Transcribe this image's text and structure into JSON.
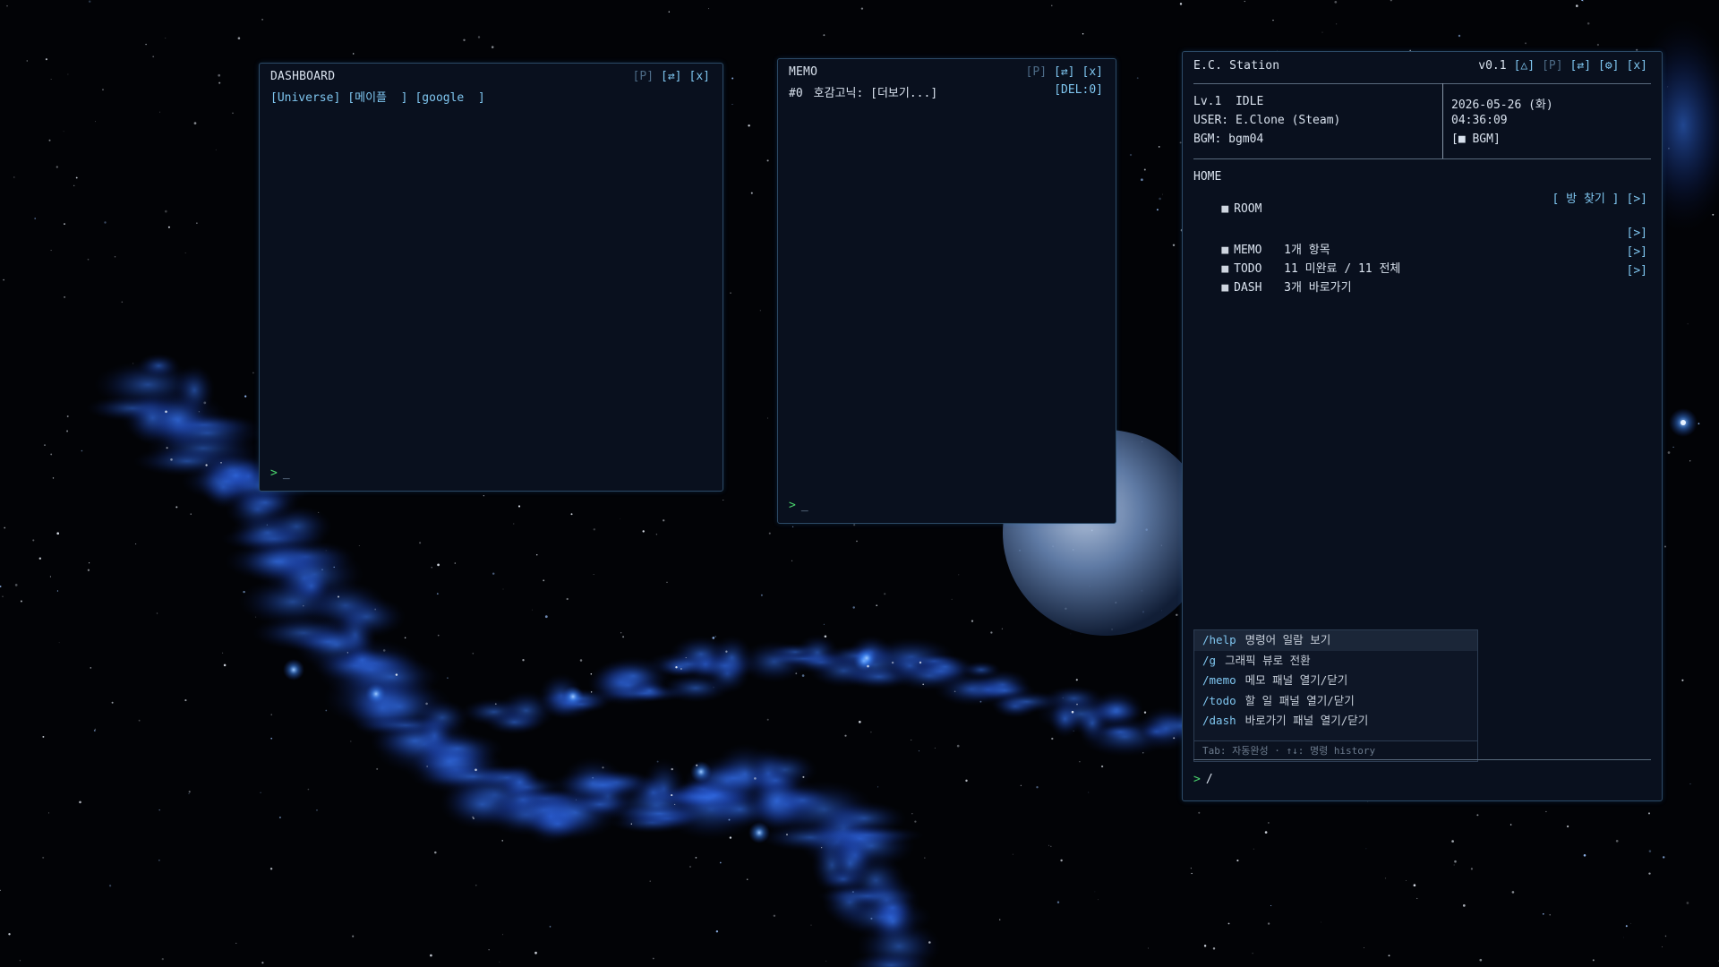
{
  "dashboard": {
    "title": "DASHBOARD",
    "buttons": {
      "pin": "[P]",
      "swap": "[⇄]",
      "close": "[x]"
    },
    "links": [
      "[Universe]",
      "[메이플  ]",
      "[google  ]"
    ],
    "prompt": ">",
    "cursor": "_"
  },
  "memo": {
    "title": "MEMO",
    "buttons": {
      "pin": "[P]",
      "swap": "[⇄]",
      "close": "[x]"
    },
    "entry": {
      "index": "#0",
      "text": "호감고닉: [더보기...]"
    },
    "del": "[DEL:0]",
    "prompt": ">",
    "cursor": "_"
  },
  "station": {
    "title": "E.C. Station",
    "version": "v0.1",
    "buttons": {
      "up": "[△]",
      "pin": "[P]",
      "swap": "[⇄]",
      "settings": "[⚙]",
      "close": "[x]"
    },
    "status": {
      "level": "Lv.1  IDLE",
      "user": "USER: E.Clone (Steam)",
      "bgm": "BGM: bgm04",
      "date": "2026-05-26 (화)",
      "time": "04:36:09",
      "bgm_toggle": "[■ BGM]"
    },
    "home_label": "HOME",
    "room": {
      "label": "ROOM",
      "find": "[ 방 찾기 ]",
      "go": "[>]"
    },
    "rows": [
      {
        "label": "MEMO",
        "value": "1개 항목",
        "go": "[>]"
      },
      {
        "label": "TODO",
        "value": "11 미완료 / 11 전체",
        "go": "[>]"
      },
      {
        "label": "DASH",
        "value": "3개 바로가기",
        "go": "[>]"
      }
    ],
    "autocomplete": {
      "items": [
        {
          "cmd": "/help",
          "desc": "명령어 일람 보기"
        },
        {
          "cmd": "/g",
          "desc": "그래픽 뷰로 전환"
        },
        {
          "cmd": "/memo",
          "desc": "메모 패널 열기/닫기"
        },
        {
          "cmd": "/todo",
          "desc": "할 일 패널 열기/닫기"
        },
        {
          "cmd": "/dash",
          "desc": "바로가기 패널 열기/닫기"
        }
      ],
      "hint": "Tab: 자동완성 · ↑↓: 명령 history"
    },
    "prompt": ">",
    "input_value": "/"
  },
  "colors": {
    "accent": "#7fc6f0",
    "prompt": "#4ad56e",
    "panel_bg": "#09101e",
    "panel_border": "#2c4a66"
  }
}
